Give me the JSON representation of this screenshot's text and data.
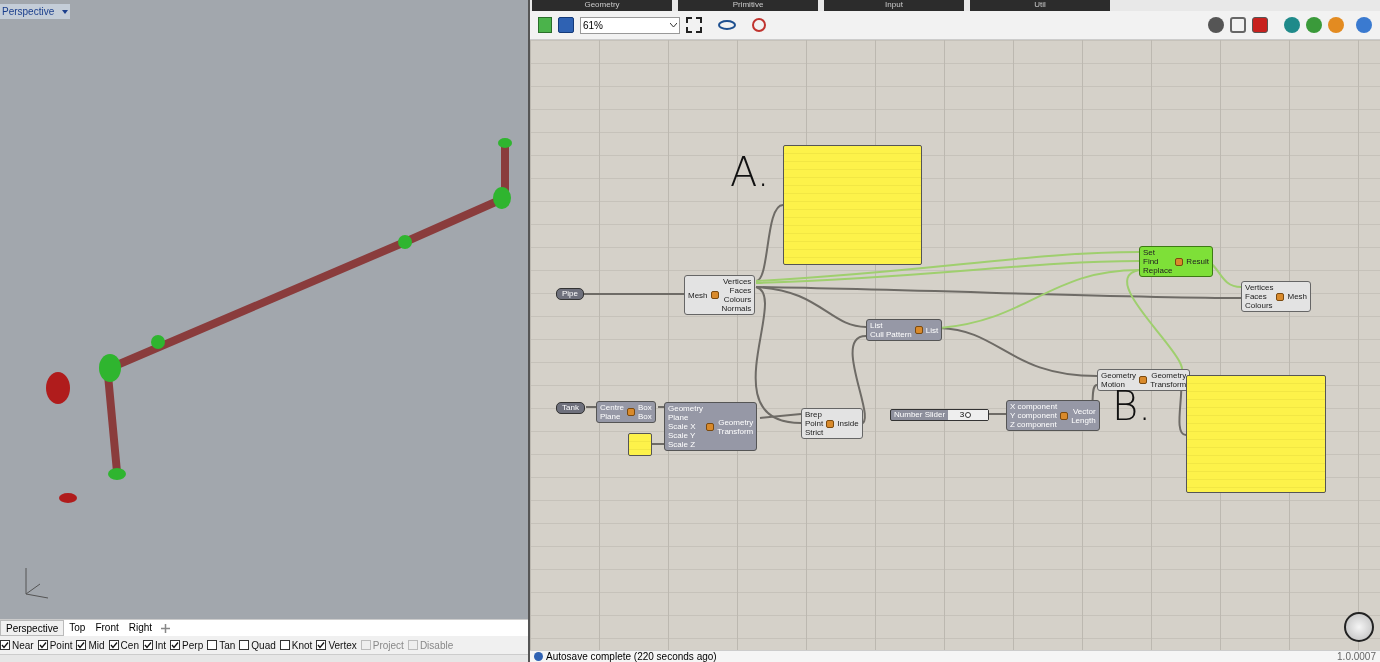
{
  "viewport": {
    "title": "Perspective",
    "tabs": [
      {
        "label": "Perspective",
        "selected": true
      },
      {
        "label": "Top",
        "selected": false
      },
      {
        "label": "Front",
        "selected": false
      },
      {
        "label": "Right",
        "selected": false
      }
    ],
    "osnaps": [
      {
        "label": "Near",
        "checked": true,
        "disabled": false
      },
      {
        "label": "Point",
        "checked": true,
        "disabled": false
      },
      {
        "label": "Mid",
        "checked": true,
        "disabled": false
      },
      {
        "label": "Cen",
        "checked": true,
        "disabled": false
      },
      {
        "label": "Int",
        "checked": true,
        "disabled": false
      },
      {
        "label": "Perp",
        "checked": true,
        "disabled": false
      },
      {
        "label": "Tan",
        "checked": false,
        "disabled": false
      },
      {
        "label": "Quad",
        "checked": false,
        "disabled": false
      },
      {
        "label": "Knot",
        "checked": false,
        "disabled": false
      },
      {
        "label": "Vertex",
        "checked": true,
        "disabled": false
      },
      {
        "label": "Project",
        "checked": false,
        "disabled": true
      },
      {
        "label": "Disable",
        "checked": false,
        "disabled": true
      }
    ]
  },
  "editor": {
    "ribbon_tabs": [
      "Geometry",
      "Primitive",
      "Input",
      "Util"
    ],
    "zoom": "61%",
    "nodes": [
      {
        "kind": "param",
        "label": "Pipe"
      },
      {
        "kind": "component",
        "inputs": [
          "Mesh"
        ],
        "outputs": [
          "Vertices",
          "Faces",
          "Colours",
          "Normals"
        ],
        "preview": true,
        "selected": false
      },
      {
        "kind": "panel"
      },
      {
        "kind": "component",
        "inputs": [
          "Set",
          "Find",
          "Replace"
        ],
        "outputs": [
          "Result"
        ],
        "preview": false,
        "selected": true
      },
      {
        "kind": "component",
        "inputs": [
          "Vertices",
          "Faces",
          "Colours"
        ],
        "outputs": [
          "Mesh"
        ],
        "preview": true,
        "selected": false
      },
      {
        "kind": "component",
        "inputs": [
          "List",
          "Cull Pattern"
        ],
        "outputs": [
          "List"
        ],
        "preview": false,
        "selected": false
      },
      {
        "kind": "param",
        "label": "Tank"
      },
      {
        "kind": "component",
        "inputs": [
          "Centre",
          "Plane"
        ],
        "outputs": [
          "Box",
          "Box"
        ],
        "preview": false,
        "selected": false
      },
      {
        "kind": "component",
        "inputs": [
          "Geometry",
          "Plane",
          "Scale X",
          "Scale Y",
          "Scale Z"
        ],
        "outputs": [
          "Geometry",
          "Transform"
        ],
        "preview": false,
        "selected": false
      },
      {
        "kind": "panel"
      },
      {
        "kind": "component",
        "inputs": [
          "Brep",
          "Point",
          "Strict"
        ],
        "outputs": [
          "Inside"
        ],
        "preview": true,
        "selected": false
      },
      {
        "kind": "slider",
        "label": "Number Slider",
        "value": "3",
        "level": 0.5
      },
      {
        "kind": "component",
        "inputs": [
          "X component",
          "Y component",
          "Z component"
        ],
        "outputs": [
          "Vector",
          "Length"
        ],
        "preview": false,
        "selected": false
      },
      {
        "kind": "component",
        "inputs": [
          "Geometry",
          "Motion"
        ],
        "outputs": [
          "Geometry",
          "Transform"
        ],
        "preview": true,
        "selected": false
      },
      {
        "kind": "panel"
      }
    ],
    "annotations": [
      "A.",
      "B."
    ]
  },
  "status_bar": {
    "message": "Autosave complete (220 seconds ago)",
    "version": "1.0.0007"
  }
}
